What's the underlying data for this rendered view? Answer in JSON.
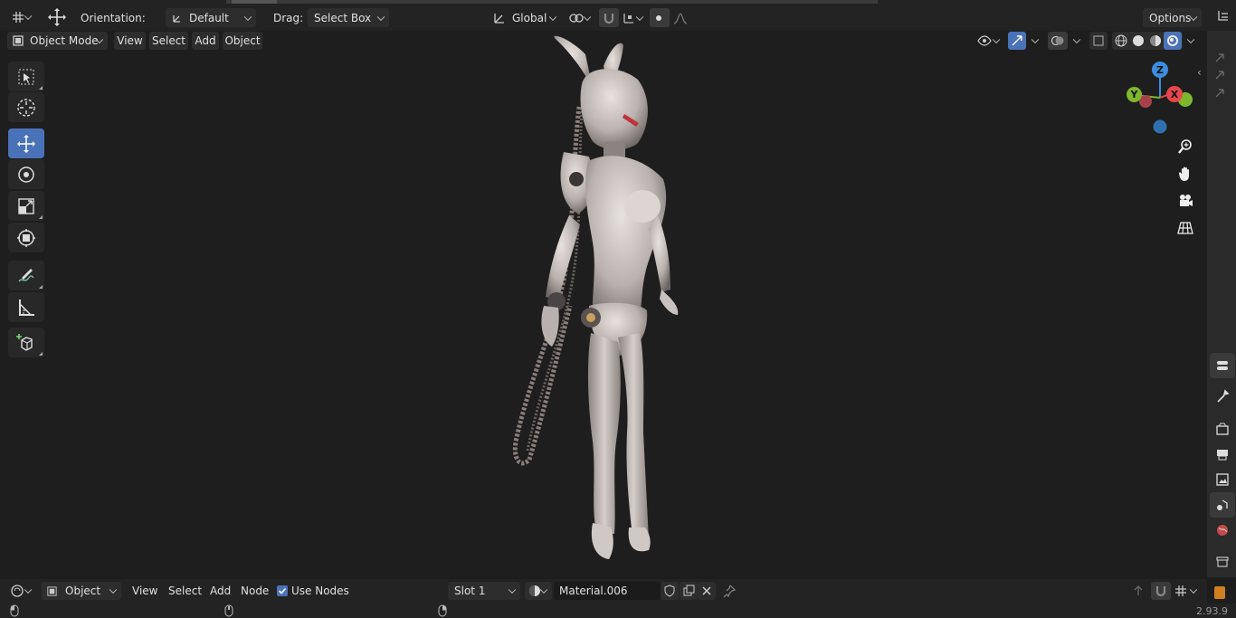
{
  "header": {
    "orientation_label": "Orientation:",
    "orientation_value": "Default",
    "drag_label": "Drag:",
    "drag_value": "Select Box",
    "transform_space": "Global",
    "options_label": "Options"
  },
  "viewport_header": {
    "mode": "Object Mode",
    "menus": [
      "View",
      "Select",
      "Add",
      "Object"
    ]
  },
  "gizmo": {
    "x_label": "X",
    "y_label": "Y",
    "z_label": "Z"
  },
  "node_editor_header": {
    "object_type": "Object",
    "menus": [
      "View",
      "Select",
      "Add",
      "Node"
    ],
    "use_nodes_label": "Use Nodes",
    "use_nodes_checked": true,
    "slot": "Slot 1",
    "material_name": "Material.006"
  },
  "status_bar": {
    "version": "2.93.9"
  },
  "colors": {
    "accent": "#4a72b8",
    "axis_x": "#e8464c",
    "axis_y": "#7eb72c",
    "axis_z": "#3b8de0"
  }
}
